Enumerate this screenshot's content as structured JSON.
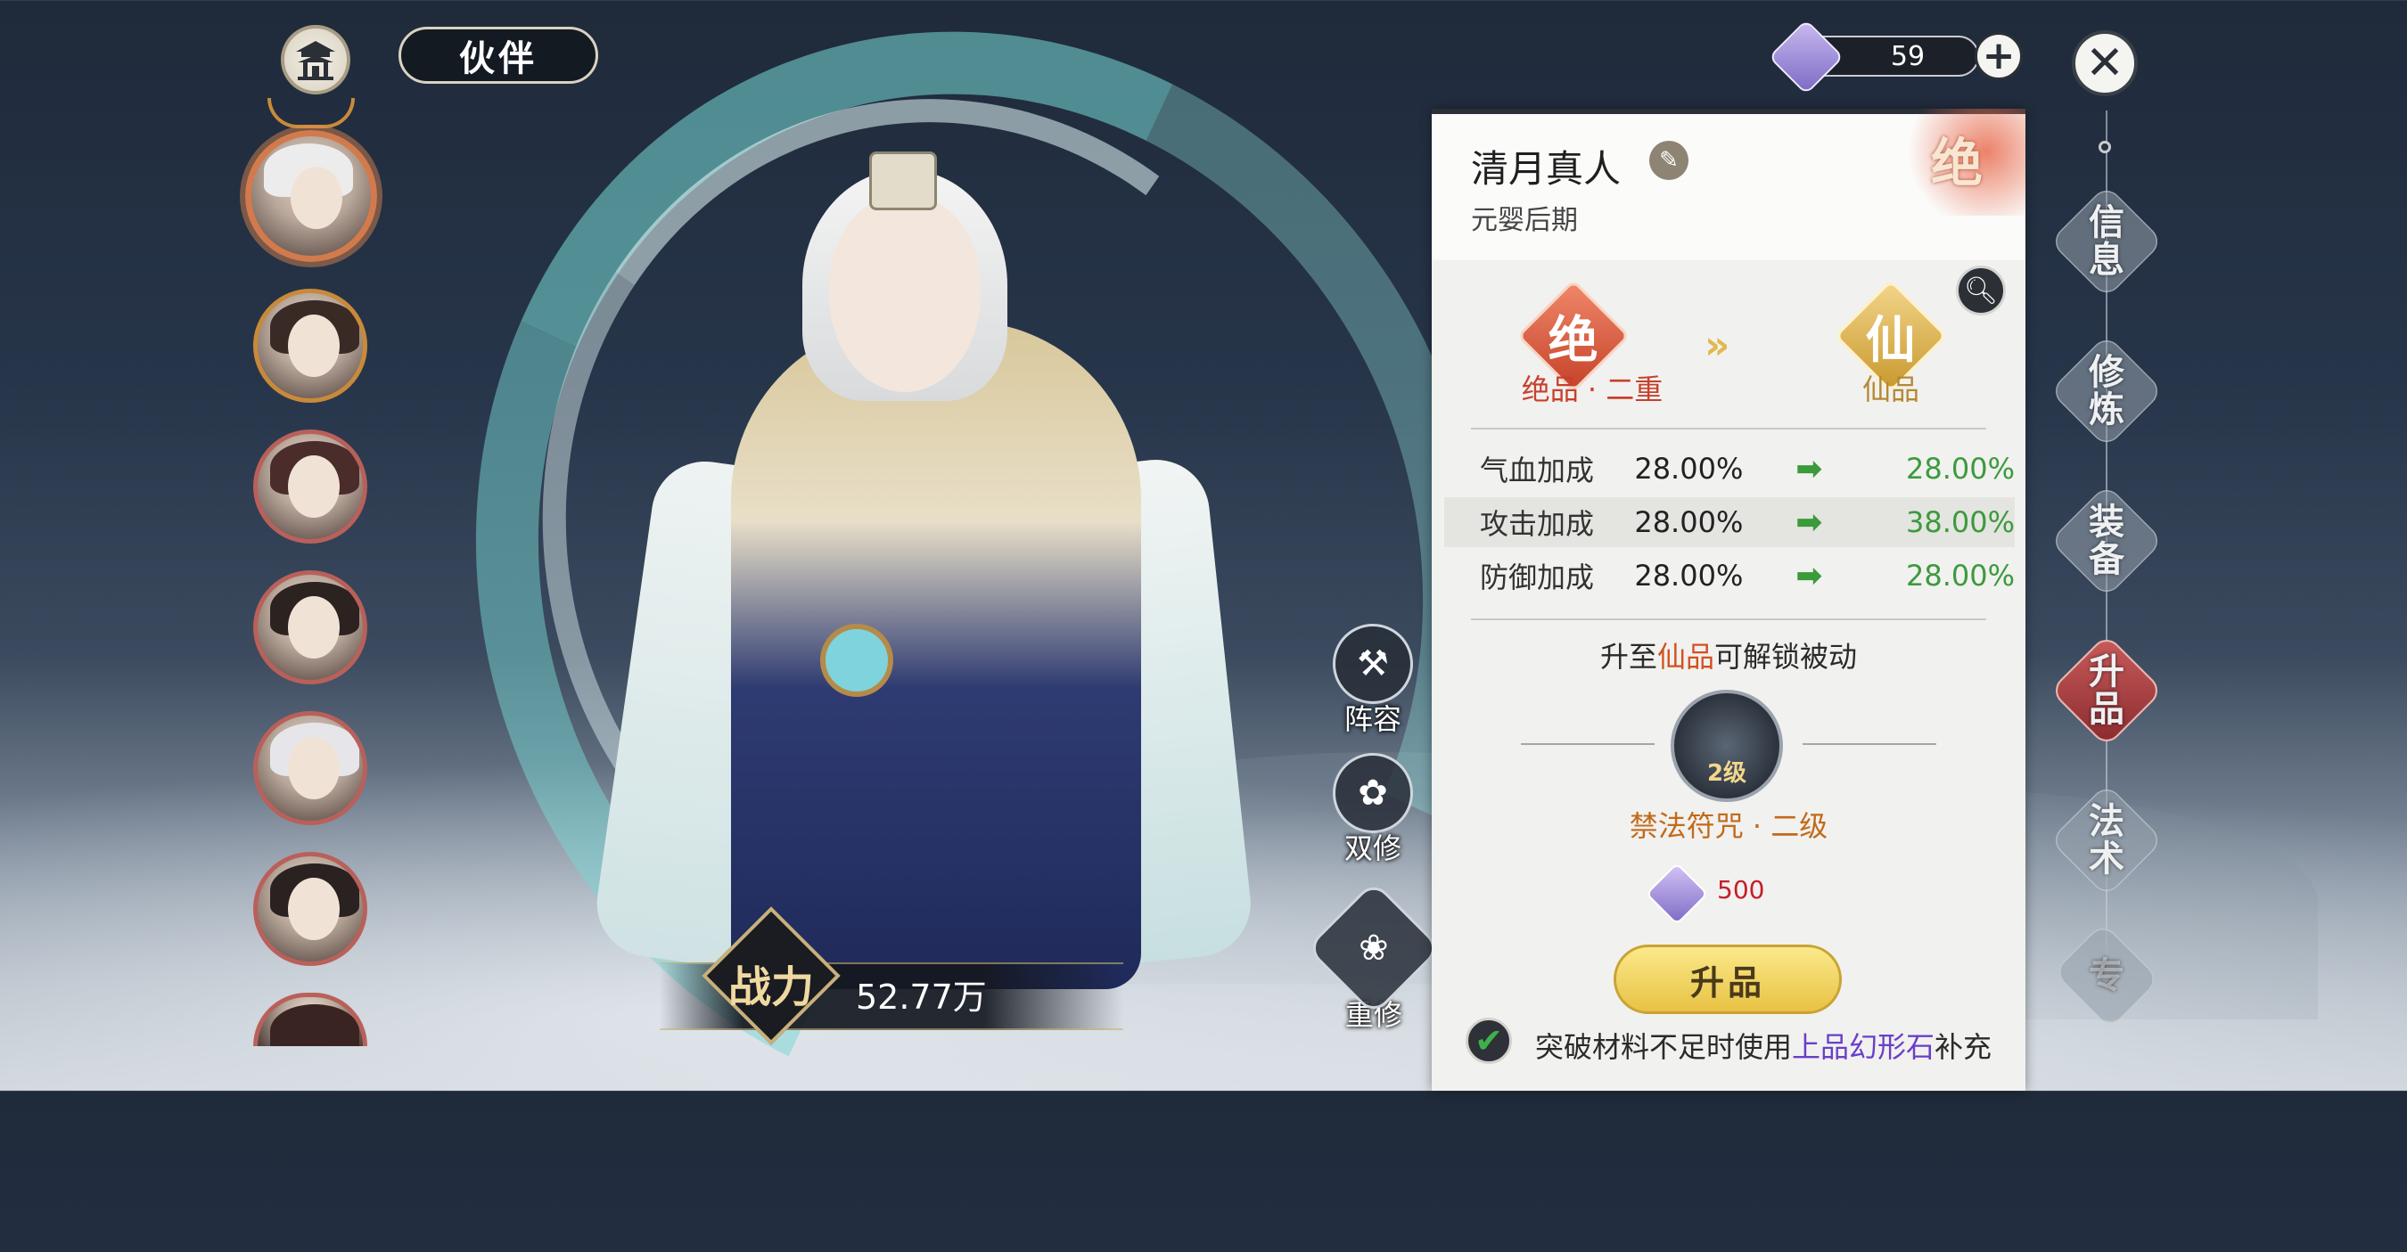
{
  "header": {
    "title": "伙伴"
  },
  "currency": {
    "amount": "59"
  },
  "portraits": [
    {
      "name": "portrait-1",
      "selected": true
    },
    {
      "name": "portrait-2"
    },
    {
      "name": "portrait-3"
    },
    {
      "name": "portrait-4"
    },
    {
      "name": "portrait-5"
    },
    {
      "name": "portrait-6"
    },
    {
      "name": "portrait-7"
    }
  ],
  "combat": {
    "label": "战力",
    "value": "52.77万"
  },
  "side_actions": [
    {
      "label": "阵容",
      "icon": "axe-icon"
    },
    {
      "label": "双修",
      "icon": "lotus-icon"
    },
    {
      "label": "重修",
      "icon": "lotus-large-icon"
    }
  ],
  "panel": {
    "name": "清月真人",
    "realm": "元婴后期",
    "grade_corner": "绝",
    "grade_from": {
      "glyph": "绝",
      "label": "绝品 · 二重"
    },
    "grade_to": {
      "glyph": "仙",
      "label": "仙品"
    },
    "stats": [
      {
        "name": "气血加成",
        "from": "28.00%",
        "to": "28.00%"
      },
      {
        "name": "攻击加成",
        "from": "28.00%",
        "to": "38.00%"
      },
      {
        "name": "防御加成",
        "from": "28.00%",
        "to": "28.00%"
      }
    ],
    "unlock": {
      "prefix": "升至",
      "grade": "仙品",
      "suffix": "可解锁被动"
    },
    "skill": {
      "level_badge": "2级",
      "name": "禁法符咒 · 二级"
    },
    "cost": "500",
    "upgrade_label": "升品",
    "auto_fill": {
      "prefix": "突破材料不足时使用",
      "item": "上品幻形石",
      "suffix": "补充"
    }
  },
  "tabs": [
    {
      "label": "信息",
      "active": false
    },
    {
      "label": "修炼",
      "active": false
    },
    {
      "label": "装备",
      "active": false
    },
    {
      "label": "升品",
      "active": true
    },
    {
      "label": "法术",
      "active": false
    },
    {
      "label": "专",
      "active": false,
      "dim": true
    }
  ],
  "colors": {
    "accent_red": "#c8402c",
    "accent_gold": "#b68935",
    "increase_green": "#3d9a3d",
    "item_purple": "#6a3fc9",
    "button_yellow": "#f0d060"
  }
}
